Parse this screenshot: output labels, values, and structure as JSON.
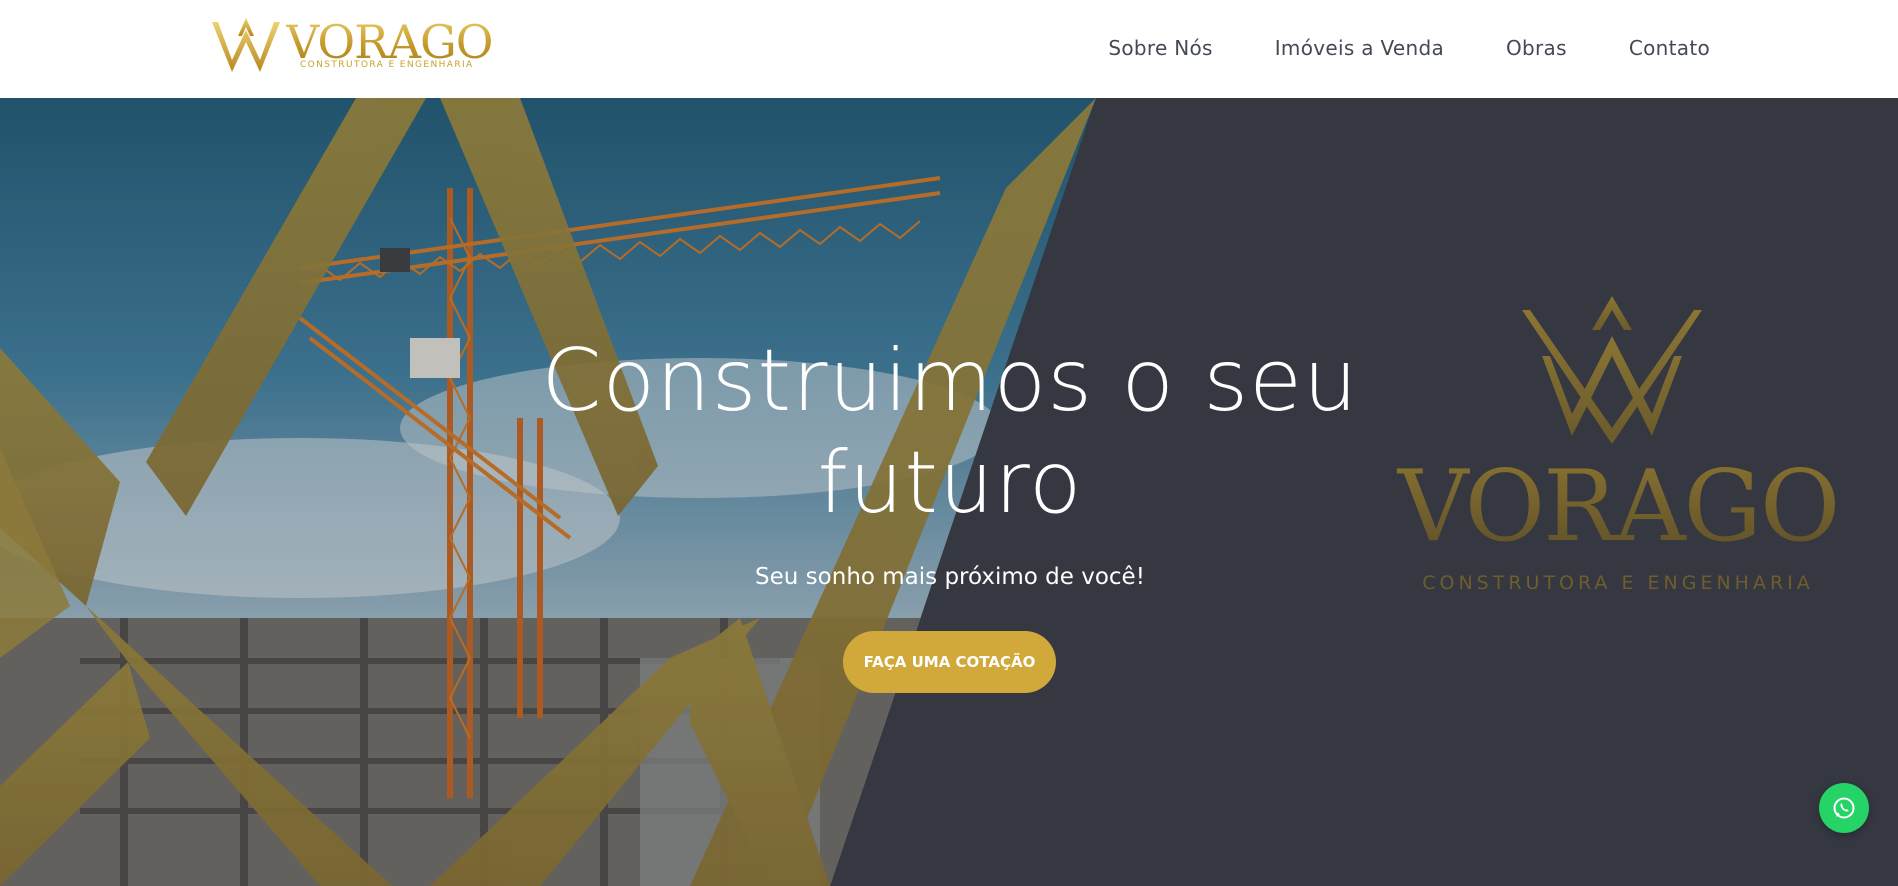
{
  "brand": {
    "name": "VORAGO",
    "tagline": "CONSTRUTORA E ENGENHARIA"
  },
  "nav": {
    "items": [
      {
        "label": "Sobre Nós"
      },
      {
        "label": "Imóveis a Venda"
      },
      {
        "label": "Obras"
      },
      {
        "label": "Contato"
      }
    ]
  },
  "hero": {
    "title_line1": "Construimos o seu",
    "title_line2": "futuro",
    "subtitle": "Seu sonho mais próximo de você!",
    "cta_label": "FAÇA UMA COTAÇÃO"
  },
  "watermark": {
    "name": "VORAGO",
    "tagline": "CONSTRUTORA E ENGENHARIA"
  },
  "floating": {
    "icon": "whatsapp-icon"
  },
  "colors": {
    "gold": "#d1a93b",
    "hero_dark": "#353741",
    "nav_text": "#444a55",
    "whatsapp": "#25d366"
  }
}
